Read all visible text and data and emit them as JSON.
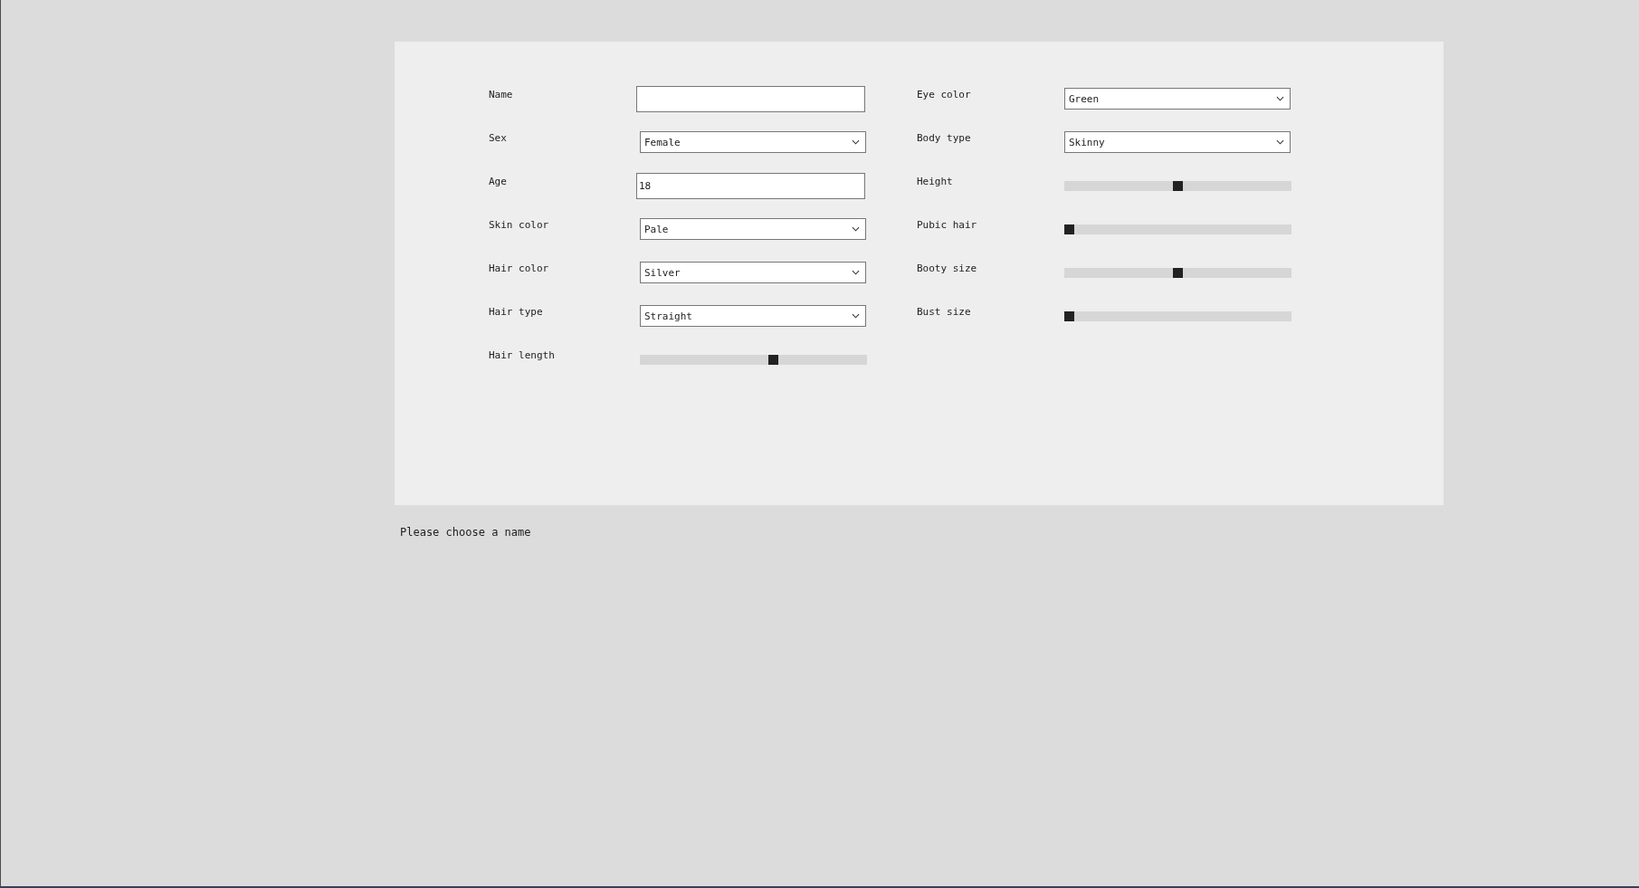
{
  "form": {
    "columns": [
      [
        {
          "kind": "text",
          "label": "Name"
        },
        {
          "kind": "select",
          "label": "Sex",
          "value": "Female"
        },
        {
          "kind": "text",
          "label": "Age",
          "value": "18"
        },
        {
          "kind": "select",
          "label": "Skin color",
          "value": "Pale"
        },
        {
          "kind": "select",
          "label": "Hair color",
          "value": "Silver"
        },
        {
          "kind": "select",
          "label": "Hair type",
          "value": "Straight"
        },
        {
          "kind": "slider",
          "label": "Hair length",
          "level": 0.59
        }
      ],
      [
        {
          "kind": "select",
          "label": "Eye color",
          "value": "Green"
        },
        {
          "kind": "select",
          "label": "Body type",
          "value": "Skinny"
        },
        {
          "kind": "slider",
          "label": "Height",
          "level": 0.5
        },
        {
          "kind": "slider",
          "label": "Pubic hair",
          "level": 0
        },
        {
          "kind": "slider",
          "label": "Booty size",
          "level": 0.5
        },
        {
          "kind": "slider",
          "label": "Bust size",
          "level": 0
        }
      ]
    ]
  },
  "message": "Please choose a name"
}
